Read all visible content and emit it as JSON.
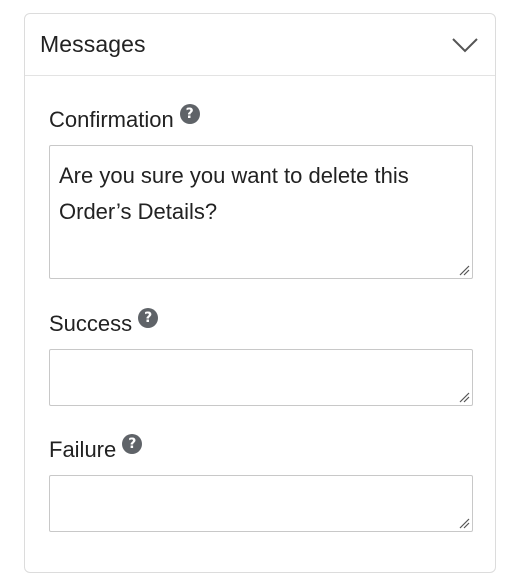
{
  "panel": {
    "title": "Messages",
    "collapse_icon": "chevron-down-icon"
  },
  "fields": {
    "confirmation": {
      "label": "Confirmation",
      "help_icon": "question-circle-icon",
      "help_glyph": "?",
      "value": "Are you sure you want to delete this Order’s Details?"
    },
    "success": {
      "label": "Success",
      "help_icon": "question-circle-icon",
      "help_glyph": "?",
      "value": ""
    },
    "failure": {
      "label": "Failure",
      "help_icon": "question-circle-icon",
      "help_glyph": "?",
      "value": ""
    }
  },
  "colors": {
    "text": "#222222",
    "border": "#c8c8c8",
    "help_icon_bg": "#5f6368"
  }
}
